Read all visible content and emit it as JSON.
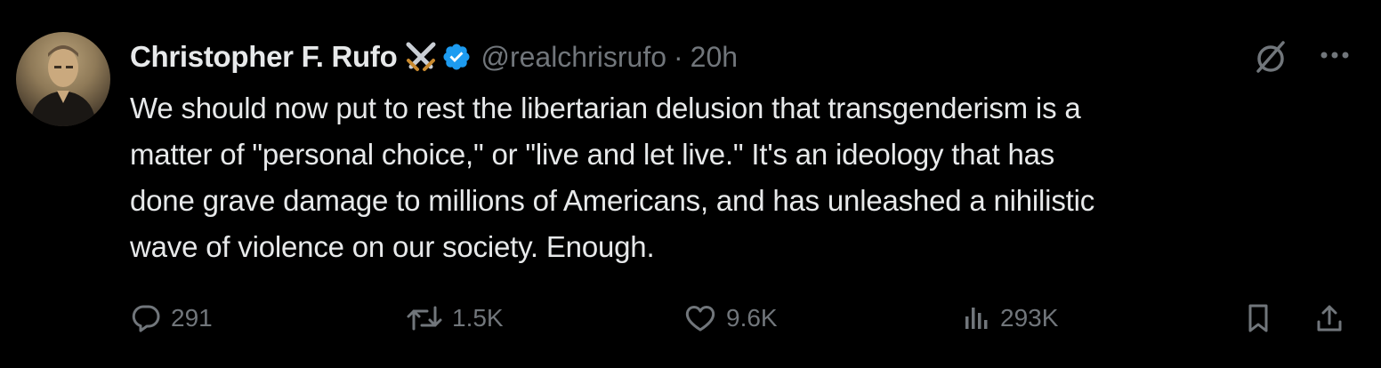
{
  "tweet": {
    "author_name": "Christopher F. Rufo",
    "handle": "@realchrisrufo",
    "separator": "·",
    "time": "20h",
    "text": "We should now put to rest the libertarian delusion that transgenderism is a\nmatter of \"personal choice,\" or \"live and let live.\" It's an ideology that has\ndone grave damage to millions of Americans, and has unleashed a nihilistic\nwave of violence on our society. Enough."
  },
  "actions": {
    "replies": "291",
    "reposts": "1.5K",
    "likes": "9.6K",
    "views": "293K"
  },
  "icons": {
    "swords": "crossed-swords-icon",
    "verified": "verified-badge-icon",
    "grok": "grok-icon",
    "more": "more-icon",
    "reply": "reply-icon",
    "repost": "repost-icon",
    "like": "heart-icon",
    "views": "views-icon",
    "bookmark": "bookmark-icon",
    "share": "share-icon"
  },
  "colors": {
    "background": "#000000",
    "text": "#e7e9ea",
    "secondary": "#71767b",
    "verified": "#1d9bf0"
  }
}
